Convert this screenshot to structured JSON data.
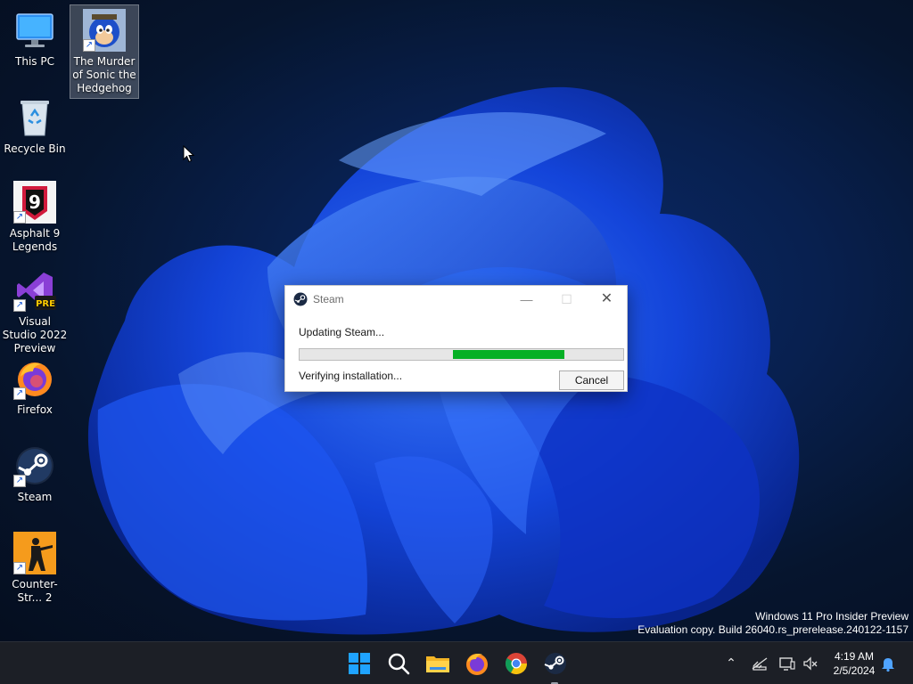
{
  "desktop": {
    "icons": [
      {
        "label": "This PC"
      },
      {
        "label": "The Murder of Sonic the Hedgehog"
      },
      {
        "label": "Recycle Bin"
      },
      {
        "label": "Asphalt 9 Legends"
      },
      {
        "label": "Visual Studio 2022 Preview",
        "badge": "PRE"
      },
      {
        "label": "Firefox"
      },
      {
        "label": "Steam"
      },
      {
        "label": "Counter-Str... 2"
      }
    ],
    "asphalt_badge_digit": "9"
  },
  "watermark": {
    "line1": "Windows 11 Pro Insider Preview",
    "line2": "Evaluation copy. Build 26040.rs_prerelease.240122-1157"
  },
  "dialog": {
    "title": "Steam",
    "status_primary": "Updating Steam...",
    "status_secondary": "Verifying installation...",
    "cancel_label": "Cancel",
    "progress": {
      "start_fraction": 0.475,
      "end_fraction": 0.82
    }
  },
  "taskbar": {
    "apps": [
      "start-icon",
      "search-icon",
      "file-explorer-icon",
      "firefox-icon",
      "chrome-icon",
      "steam-icon"
    ],
    "clock": {
      "time": "4:19 AM",
      "date": "2/5/2024"
    }
  },
  "colors": {
    "progress_fill": "#06b025",
    "taskbar_bg": "#1c1f26",
    "accent_blue": "#1a5bd6"
  }
}
